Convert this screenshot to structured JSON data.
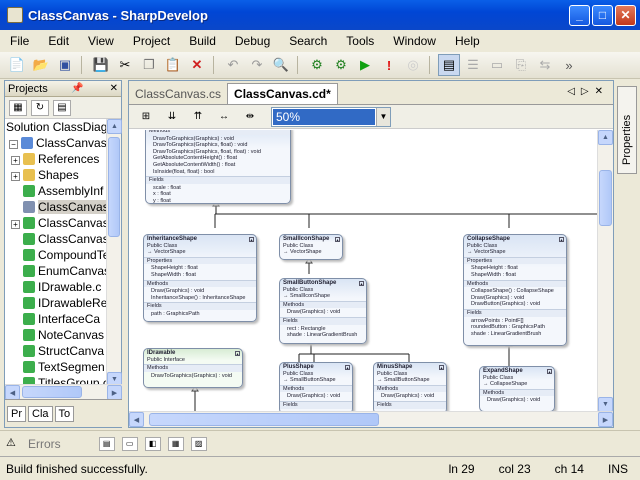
{
  "window": {
    "title": "ClassCanvas - SharpDevelop",
    "minimize": "_",
    "maximize": "□",
    "close": "✕"
  },
  "menu": [
    "File",
    "Edit",
    "View",
    "Project",
    "Build",
    "Debug",
    "Search",
    "Tools",
    "Window",
    "Help"
  ],
  "toolbar_icons": [
    "new-file",
    "open",
    "save-all",
    "save",
    "cut",
    "copy",
    "paste",
    "delete",
    "undo",
    "redo",
    "find",
    "build",
    "build-solution",
    "run",
    "stop",
    "breakpoint",
    "toggle-1",
    "toggle-2",
    "toggle-3",
    "toggle-4",
    "toggle-5",
    "toggle-6"
  ],
  "projects_pad": {
    "title": "Projects",
    "tree": [
      {
        "label": "Solution ClassDiagra",
        "level": 0,
        "icon": "solution-icon"
      },
      {
        "label": "ClassCanvas",
        "level": 1,
        "icon": "project-icon"
      },
      {
        "label": "References",
        "level": 2,
        "icon": "folder-icon",
        "expander": "+"
      },
      {
        "label": "Shapes",
        "level": 2,
        "icon": "folder-icon",
        "expander": "+"
      },
      {
        "label": "AssemblyInf",
        "level": 2,
        "icon": "csharp-file-icon"
      },
      {
        "label": "ClassCanvas",
        "level": 2,
        "icon": "class-diagram-icon",
        "selected": true
      },
      {
        "label": "ClassCanvas",
        "level": 2,
        "icon": "csharp-file-icon",
        "expander": "+"
      },
      {
        "label": "ClassCanvas",
        "level": 2,
        "icon": "csharp-file-icon"
      },
      {
        "label": "CompoundTe",
        "level": 2,
        "icon": "csharp-file-icon"
      },
      {
        "label": "EnumCanvas",
        "level": 2,
        "icon": "csharp-file-icon"
      },
      {
        "label": "IDrawable.c",
        "level": 2,
        "icon": "csharp-file-icon"
      },
      {
        "label": "IDrawableRe",
        "level": 2,
        "icon": "csharp-file-icon"
      },
      {
        "label": "InterfaceCa",
        "level": 2,
        "icon": "csharp-file-icon"
      },
      {
        "label": "NoteCanvas",
        "level": 2,
        "icon": "csharp-file-icon"
      },
      {
        "label": "StructCanva",
        "level": 2,
        "icon": "csharp-file-icon"
      },
      {
        "label": "TextSegmen",
        "level": 2,
        "icon": "csharp-file-icon"
      },
      {
        "label": "TitlesGroup.c",
        "level": 2,
        "icon": "csharp-file-icon"
      }
    ],
    "bottom_tabs": [
      "Pr",
      "Cla",
      "To"
    ]
  },
  "editor": {
    "tabs": [
      {
        "label": "ClassCanvas.cs",
        "active": false
      },
      {
        "label": "ClassCanvas.cd*",
        "active": true
      }
    ],
    "zoom": "50%"
  },
  "diagram": {
    "top_members": [
      "Methods",
      "DrawToGraphics(Graphics) : void",
      "DrawToGraphics(Graphics, float) : void",
      "DrawToGraphics(Graphics, float, float) : void",
      "GetAbsoluteContentHeight() : float",
      "GetAbsoluteContentWidth() : float",
      "IsInside(float, float) : bool",
      "Fields",
      "scale : float",
      "x : float",
      "y : float"
    ],
    "classes": [
      {
        "name": "InheritanceShape",
        "kind": "Public Class",
        "base": "→ VectorShape",
        "sections": [
          [
            "Properties",
            "ShapeHeight : float",
            "ShapeWidth : float"
          ],
          [
            "Methods",
            "Draw(Graphics) : void",
            "InheritanceShape() : InheritanceShape"
          ],
          [
            "Fields",
            "path : GraphicsPath"
          ]
        ]
      },
      {
        "name": "SmallIconShape",
        "kind": "Public Class",
        "base": "→ VectorShape",
        "sections": []
      },
      {
        "name": "CollapseShape",
        "kind": "Public Class",
        "base": "→ VectorShape",
        "sections": [
          [
            "Properties",
            "ShapeHeight : float",
            "ShapeWidth : float"
          ],
          [
            "Methods",
            "CollapseShape() : CollapseShape",
            "Draw(Graphics) : void",
            "DrawButton(Graphics) : void"
          ],
          [
            "Fields",
            "arrowPoints : PointF[]",
            "roundedButton : GraphicsPath",
            "shade : LinearGradientBrush"
          ]
        ]
      },
      {
        "name": "SmallButtonShape",
        "kind": "Public Class",
        "base": "→ SmallIconShape",
        "sections": [
          [
            "Methods",
            "Draw(Graphics) : void"
          ],
          [
            "Fields",
            "rect : Rectangle",
            "shade : LinearGradientBrush"
          ]
        ]
      },
      {
        "name": "IDrawable",
        "kind": "Public Interface",
        "base": "",
        "sections": [
          [
            "Methods",
            "DrawToGraphics(Graphics) : void"
          ]
        ]
      },
      {
        "name": "PlusShape",
        "kind": "Public Class",
        "base": "→ SmallButtonShape",
        "sections": [
          [
            "Methods",
            "Draw(Graphics) : void"
          ],
          [
            "Fields"
          ]
        ]
      },
      {
        "name": "MinusShape",
        "kind": "Public Class",
        "base": "→ SmallButtonShape",
        "sections": [
          [
            "Methods",
            "Draw(Graphics) : void"
          ],
          [
            "Fields"
          ]
        ]
      },
      {
        "name": "ExpandShape",
        "kind": "Public Class",
        "base": "→ CollapseShape",
        "sections": [
          [
            "Methods",
            "Draw(Graphics) : void"
          ]
        ]
      }
    ]
  },
  "right_pad": {
    "label": "Properties"
  },
  "errors_bar": {
    "label": "Errors"
  },
  "status": {
    "message": "Build finished successfully.",
    "line": "ln 29",
    "col": "col 23",
    "ch": "ch 14",
    "mode": "INS"
  }
}
